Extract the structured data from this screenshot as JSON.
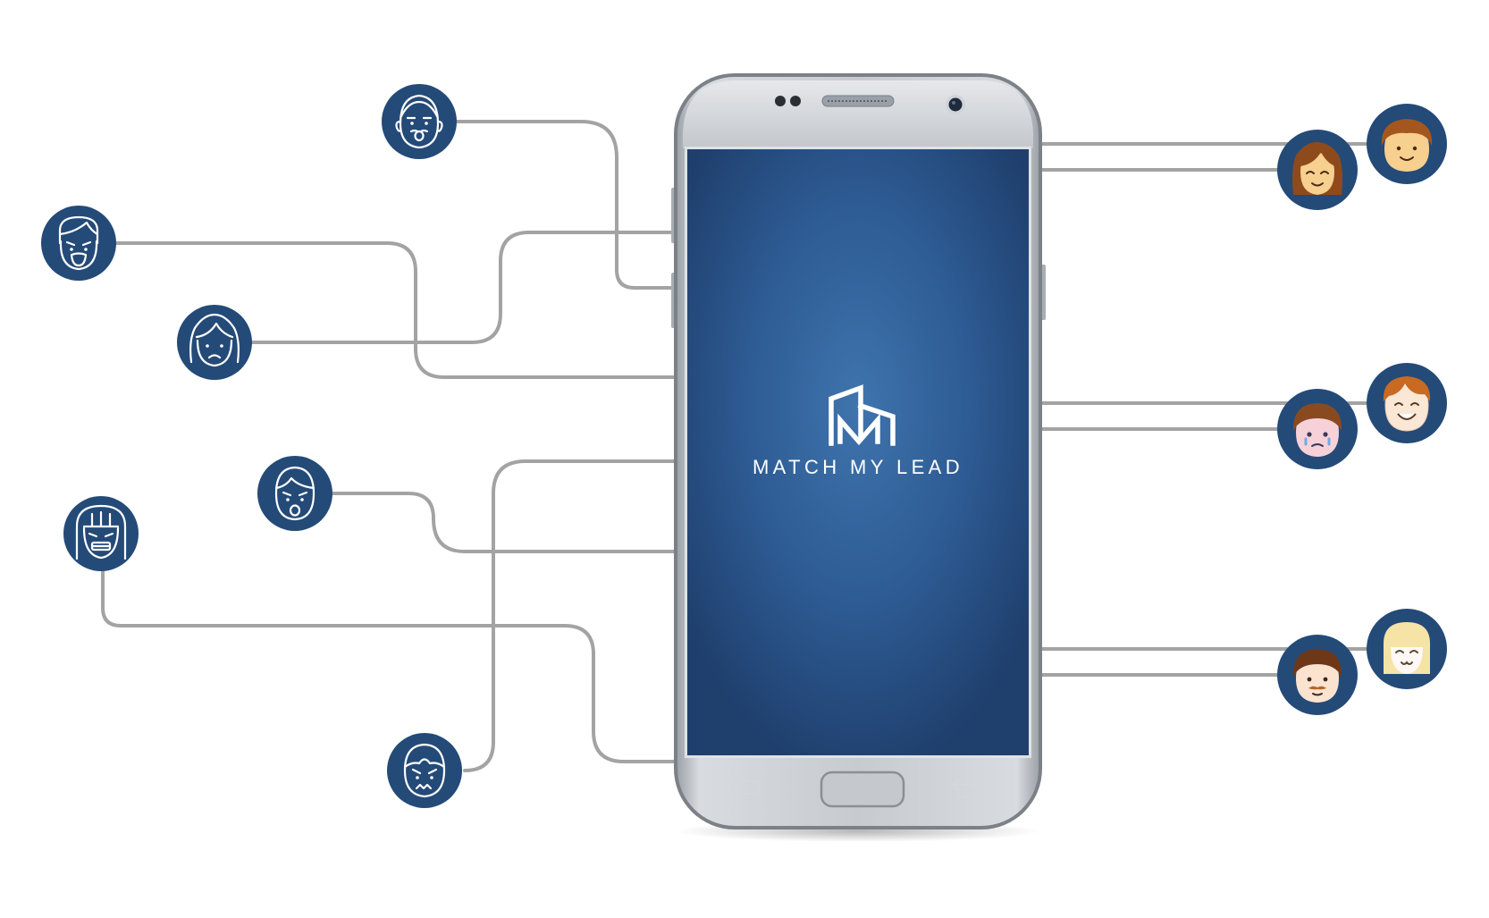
{
  "app": {
    "brand_name": "MATCH MY LEAD"
  },
  "colors": {
    "badge_navy": "#244a78",
    "connector_gray": "#a3a3a3",
    "screen_blue": "#2f5f99",
    "phone_silver": "#c6cacf"
  },
  "icons": {
    "left": [
      "surprised-man-outline-icon",
      "shouting-man-outline-icon",
      "sad-woman-outline-icon",
      "shocked-boy-outline-icon",
      "grimacing-woman-outline-icon",
      "angry-boy-outline-icon"
    ],
    "right": [
      "smiling-woman-color-icon",
      "smiling-boy-color-icon",
      "crying-boy-color-icon",
      "laughing-man-color-icon",
      "mustache-man-color-icon",
      "happy-blonde-girl-color-icon"
    ],
    "logo": "building-m-logo-icon"
  }
}
